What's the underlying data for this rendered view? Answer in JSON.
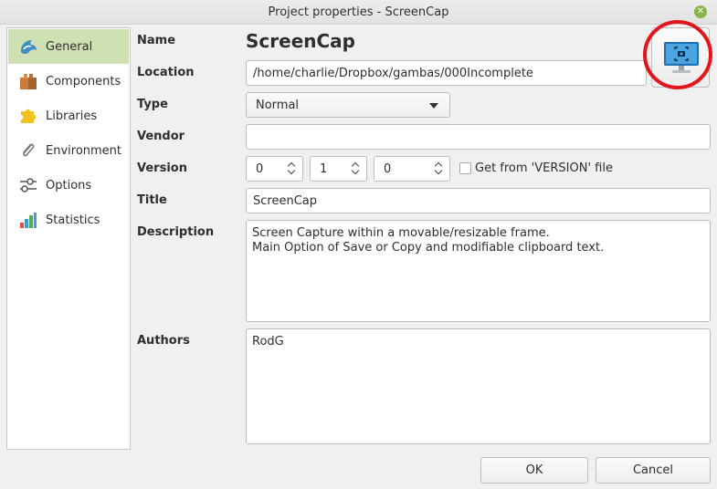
{
  "window": {
    "title": "Project properties - ScreenCap",
    "close_glyph": "✕"
  },
  "sidebar": {
    "items": [
      {
        "label": "General",
        "icon": "gambas-bird-icon",
        "active": true
      },
      {
        "label": "Components",
        "icon": "package-icon"
      },
      {
        "label": "Libraries",
        "icon": "puzzle-icon"
      },
      {
        "label": "Environment",
        "icon": "paperclip-icon"
      },
      {
        "label": "Options",
        "icon": "sliders-icon"
      },
      {
        "label": "Statistics",
        "icon": "bar-chart-icon"
      }
    ]
  },
  "form": {
    "name_label": "Name",
    "name_value": "ScreenCap",
    "location_label": "Location",
    "location_value": "/home/charlie/Dropbox/gambas/000Incomplete",
    "type_label": "Type",
    "type_value": "Normal",
    "vendor_label": "Vendor",
    "vendor_value": "",
    "version_label": "Version",
    "version_major": "0",
    "version_minor": "1",
    "version_patch": "0",
    "version_file_label": "Get from 'VERSION' file",
    "title_label": "Title",
    "title_value": "ScreenCap",
    "description_label": "Description",
    "description_line1": "Screen Capture within a movable/resizable frame.",
    "description_line2": "Main Option of Save or Copy and modifiable clipboard text.",
    "authors_label": "Authors",
    "authors_value": "RodG"
  },
  "project_icon": {
    "icon": "monitor-screenshot-icon",
    "highlight_color": "#e3141b"
  },
  "buttons": {
    "ok": "OK",
    "cancel": "Cancel"
  },
  "colors": {
    "accent": "#cfe0b2",
    "close": "#8ab34a"
  }
}
